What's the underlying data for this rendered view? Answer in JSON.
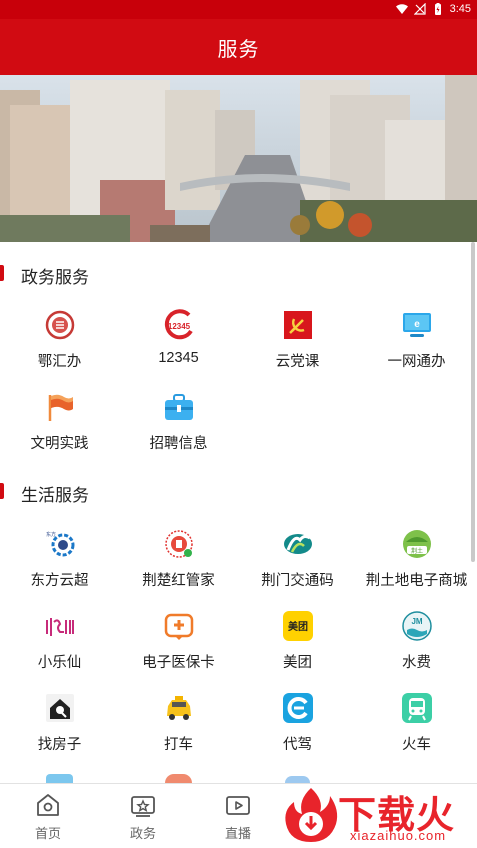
{
  "status_bar": {
    "time": "3:45"
  },
  "header": {
    "title": "服务"
  },
  "sections": [
    {
      "title": "政务服务",
      "items": [
        {
          "label": "鄂汇办",
          "icon": "ehuiban-icon"
        },
        {
          "label": "12345",
          "icon": "hotline-12345-icon"
        },
        {
          "label": "云党课",
          "icon": "party-flag-icon"
        },
        {
          "label": "一网通办",
          "icon": "computer-monitor-icon"
        },
        {
          "label": "文明实践",
          "icon": "red-flag-icon"
        },
        {
          "label": "招聘信息",
          "icon": "briefcase-icon"
        }
      ]
    },
    {
      "title": "生活服务",
      "items": [
        {
          "label": "东方云超",
          "icon": "dongfang-yunchao-icon"
        },
        {
          "label": "荆楚红管家",
          "icon": "jingchu-housekeeper-icon"
        },
        {
          "label": "荆门交通码",
          "icon": "traffic-code-icon"
        },
        {
          "label": "荆土地电子商城",
          "icon": "land-mall-icon"
        },
        {
          "label": "小乐仙",
          "icon": "xiaolexian-icon"
        },
        {
          "label": "电子医保卡",
          "icon": "medical-card-icon"
        },
        {
          "label": "美团",
          "icon": "meituan-icon"
        },
        {
          "label": "水费",
          "icon": "water-bill-icon"
        },
        {
          "label": "找房子",
          "icon": "house-search-icon"
        },
        {
          "label": "打车",
          "icon": "taxi-icon"
        },
        {
          "label": "代驾",
          "icon": "designated-driver-icon"
        },
        {
          "label": "火车",
          "icon": "train-icon"
        }
      ]
    }
  ],
  "tabbar": {
    "items": [
      {
        "label": "首页",
        "icon": "home-icon"
      },
      {
        "label": "政务",
        "icon": "government-icon"
      },
      {
        "label": "直播",
        "icon": "live-video-icon"
      }
    ]
  },
  "watermark": {
    "text": "下载火",
    "url_text": "xiazaihuo.com"
  },
  "colors": {
    "brand_red": "#d10b12",
    "status_red": "#c8000a"
  }
}
